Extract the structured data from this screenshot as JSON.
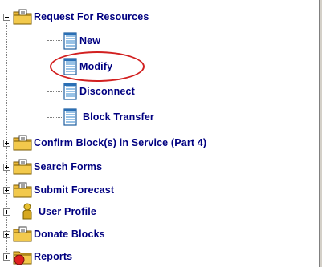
{
  "tree": {
    "request": {
      "label": "Request For Resources",
      "children": {
        "new": "New",
        "modify": "Modify",
        "disconnect": "Disconnect",
        "block_transfer": "Block Transfer"
      }
    },
    "confirm_blocks": "Confirm Block(s) in Service (Part 4)",
    "search_forms": "Search Forms",
    "submit_forecast": "Submit Forecast",
    "user_profile": "User Profile",
    "donate_blocks": "Donate Blocks",
    "reports": "Reports"
  },
  "colors": {
    "label": "#000080",
    "highlight_ring": "#d22020",
    "folder": "#f2c94c",
    "document": "#5a9ed6"
  },
  "icons": {
    "folder": "folder-icon",
    "document": "document-icon",
    "user": "user-icon",
    "reports": "reports-icon"
  }
}
